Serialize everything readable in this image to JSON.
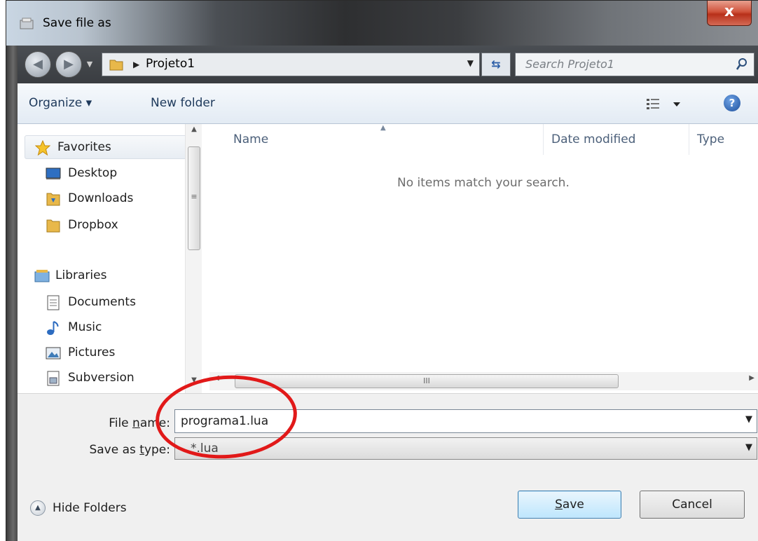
{
  "window": {
    "title": "Save file as",
    "close_label": "x"
  },
  "nav": {
    "back_icon": "back-arrow-icon",
    "forward_icon": "forward-arrow-icon"
  },
  "address": {
    "path": "Projeto1"
  },
  "search": {
    "placeholder": "Search Projeto1"
  },
  "toolbar": {
    "organize_label": "Organize ▾",
    "new_folder_label": "New folder",
    "help_label": "?"
  },
  "sidebar": {
    "favorites": {
      "label": "Favorites",
      "items": [
        "Desktop",
        "Downloads",
        "Dropbox"
      ]
    },
    "libraries": {
      "label": "Libraries",
      "items": [
        "Documents",
        "Music",
        "Pictures",
        "Subversion"
      ]
    }
  },
  "filelist": {
    "columns": [
      "Name",
      "Date modified",
      "Type"
    ],
    "empty_message": "No items match your search.",
    "scroll_thumb_label": "III"
  },
  "form": {
    "filename_label_pre": "File ",
    "filename_label_u": "n",
    "filename_label_post": "ame:",
    "filename_value": "programa1.lua",
    "type_label_pre": "Save as ",
    "type_label_u": "t",
    "type_label_post": "ype:",
    "type_value": "*.lua"
  },
  "footer": {
    "hide_folders_label": "Hide Folders",
    "save_u": "S",
    "save_rest": "ave",
    "cancel_label": "Cancel"
  },
  "colors": {
    "annotation": "#e11919",
    "accent": "#3c7fb1"
  }
}
